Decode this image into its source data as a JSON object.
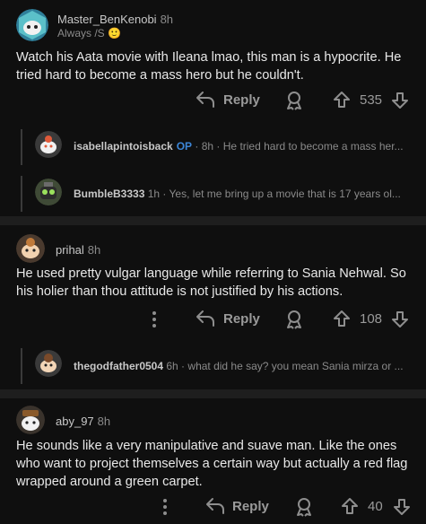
{
  "comments": [
    {
      "username": "Master_BenKenobi",
      "time": "8h",
      "flair": "Always /S 🙂",
      "body": "Watch his Aata movie with Ileana lmao, this man is a hypocrite. He tried hard to become a mass hero but he couldn't.",
      "reply_label": "Reply",
      "score": "535",
      "replies": [
        {
          "username": "isabellapintoisback",
          "op": "OP",
          "time": "· 8h ·",
          "text": "He tried hard to become a mass her..."
        },
        {
          "username": "BumbleB3333",
          "time": "1h ·",
          "text": "Yes, let me bring up a movie that is 17 years ol..."
        }
      ]
    },
    {
      "username": "prihal",
      "time": "8h",
      "body": "He used pretty vulgar language while referring to Sania Nehwal. So his holier than thou attitude is not justified by his actions.",
      "reply_label": "Reply",
      "score": "108",
      "replies": [
        {
          "username": "thegodfather0504",
          "time": "6h ·",
          "text": "what did he say? you mean Sania mirza or ..."
        }
      ]
    },
    {
      "username": "aby_97",
      "time": "8h",
      "body": "He sounds like a very manipulative and suave man. Like the ones who want to project themselves a certain way but actually a red flag wrapped around a green  carpet.",
      "reply_label": "Reply",
      "score": "40"
    }
  ],
  "colors": {
    "background": "#0f0f0f",
    "separator": "#1e1e1e",
    "op_badge": "#3d87d8",
    "text": "#e8e8e8",
    "muted": "#8a8a8a"
  },
  "icons": [
    "more-icon",
    "reply-arrow-icon",
    "award-icon",
    "upvote-icon",
    "downvote-icon"
  ]
}
